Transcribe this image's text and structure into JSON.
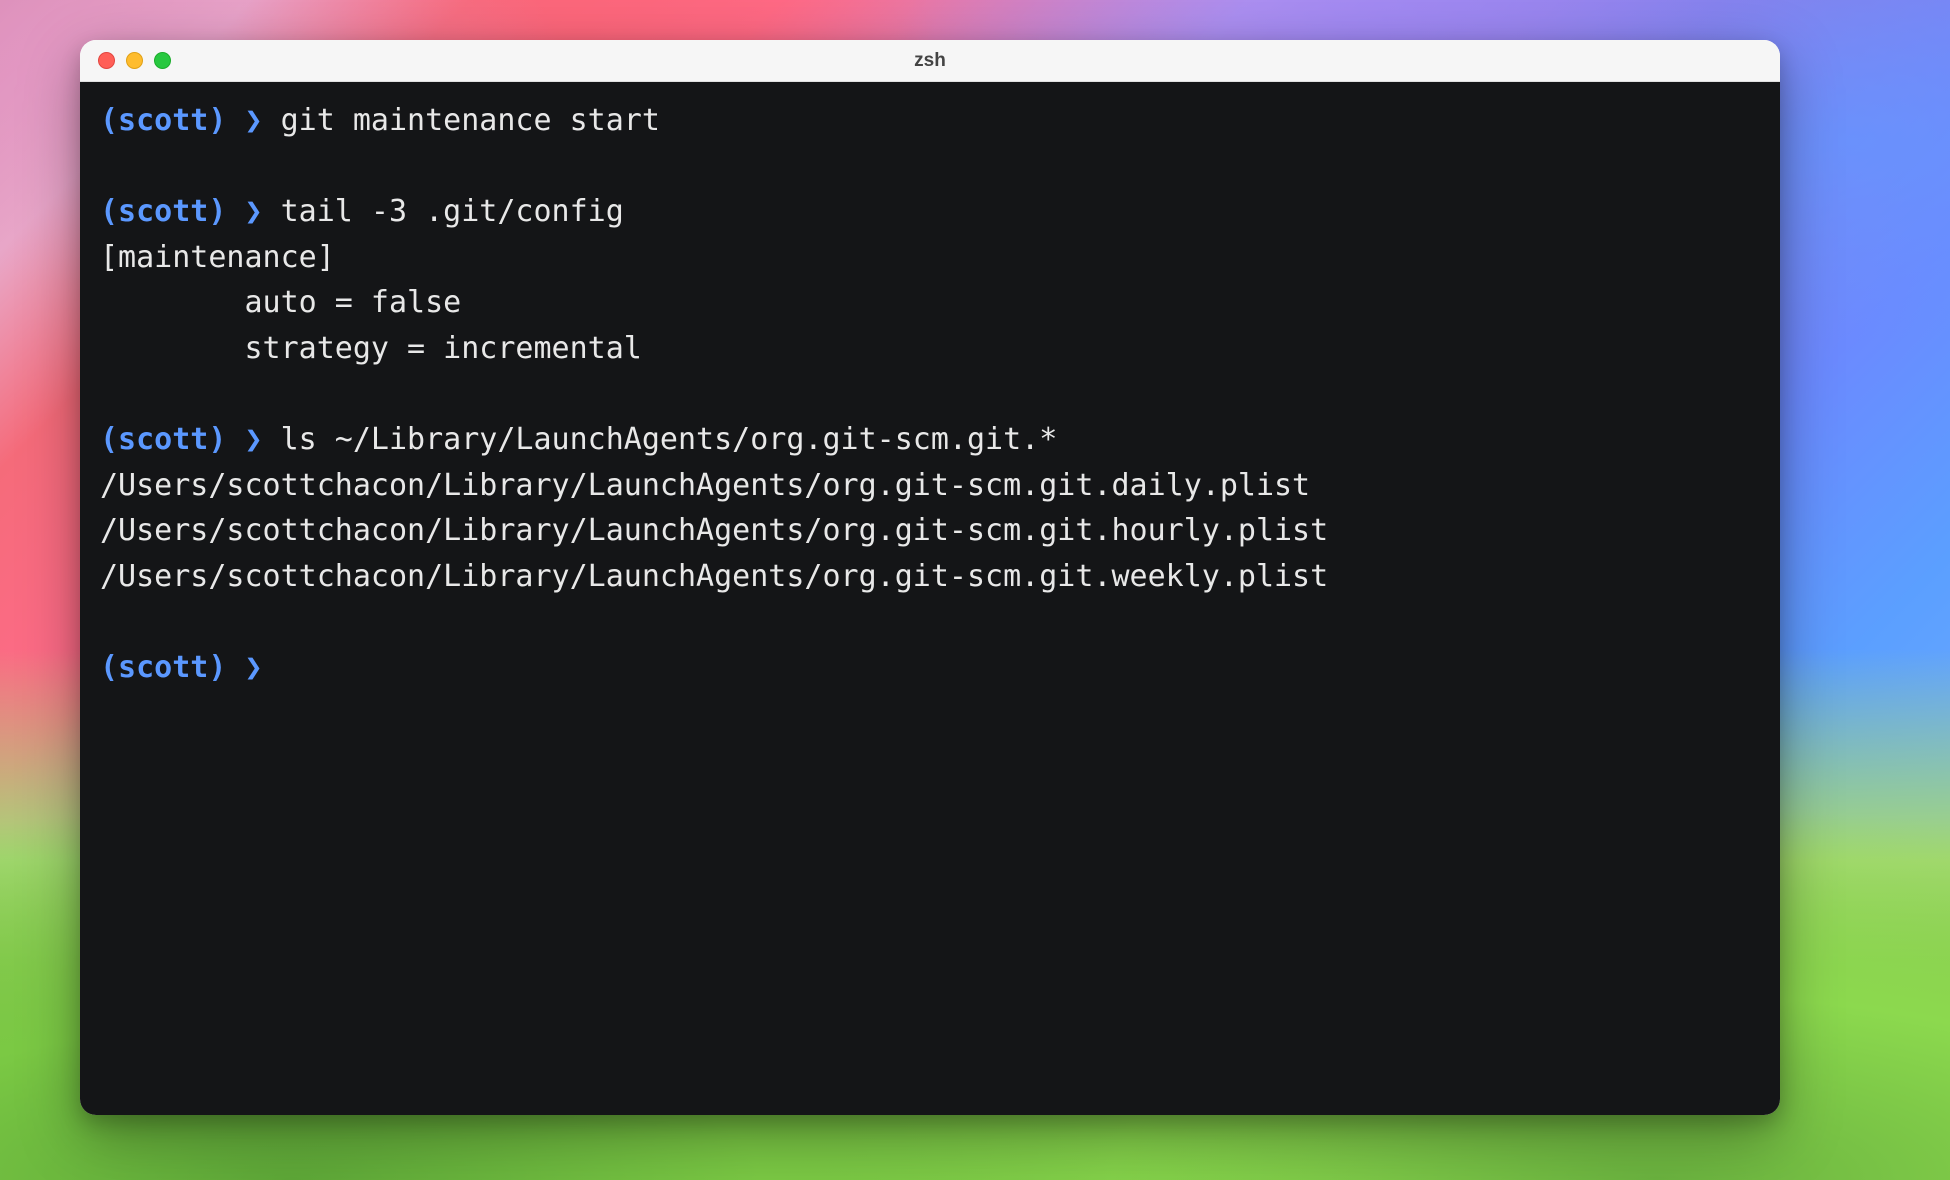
{
  "window": {
    "title": "zsh"
  },
  "terminal": {
    "prompt_user": "(scott)",
    "prompt_symbol": "❯",
    "blocks": [
      {
        "command": "git maintenance start",
        "output": []
      },
      {
        "command": "tail -3 .git/config",
        "output": [
          "[maintenance]",
          "        auto = false",
          "        strategy = incremental"
        ]
      },
      {
        "command": "ls ~/Library/LaunchAgents/org.git-scm.git.*",
        "output": [
          "/Users/scottchacon/Library/LaunchAgents/org.git-scm.git.daily.plist",
          "/Users/scottchacon/Library/LaunchAgents/org.git-scm.git.hourly.plist",
          "/Users/scottchacon/Library/LaunchAgents/org.git-scm.git.weekly.plist"
        ]
      },
      {
        "command": "",
        "output": []
      }
    ]
  }
}
